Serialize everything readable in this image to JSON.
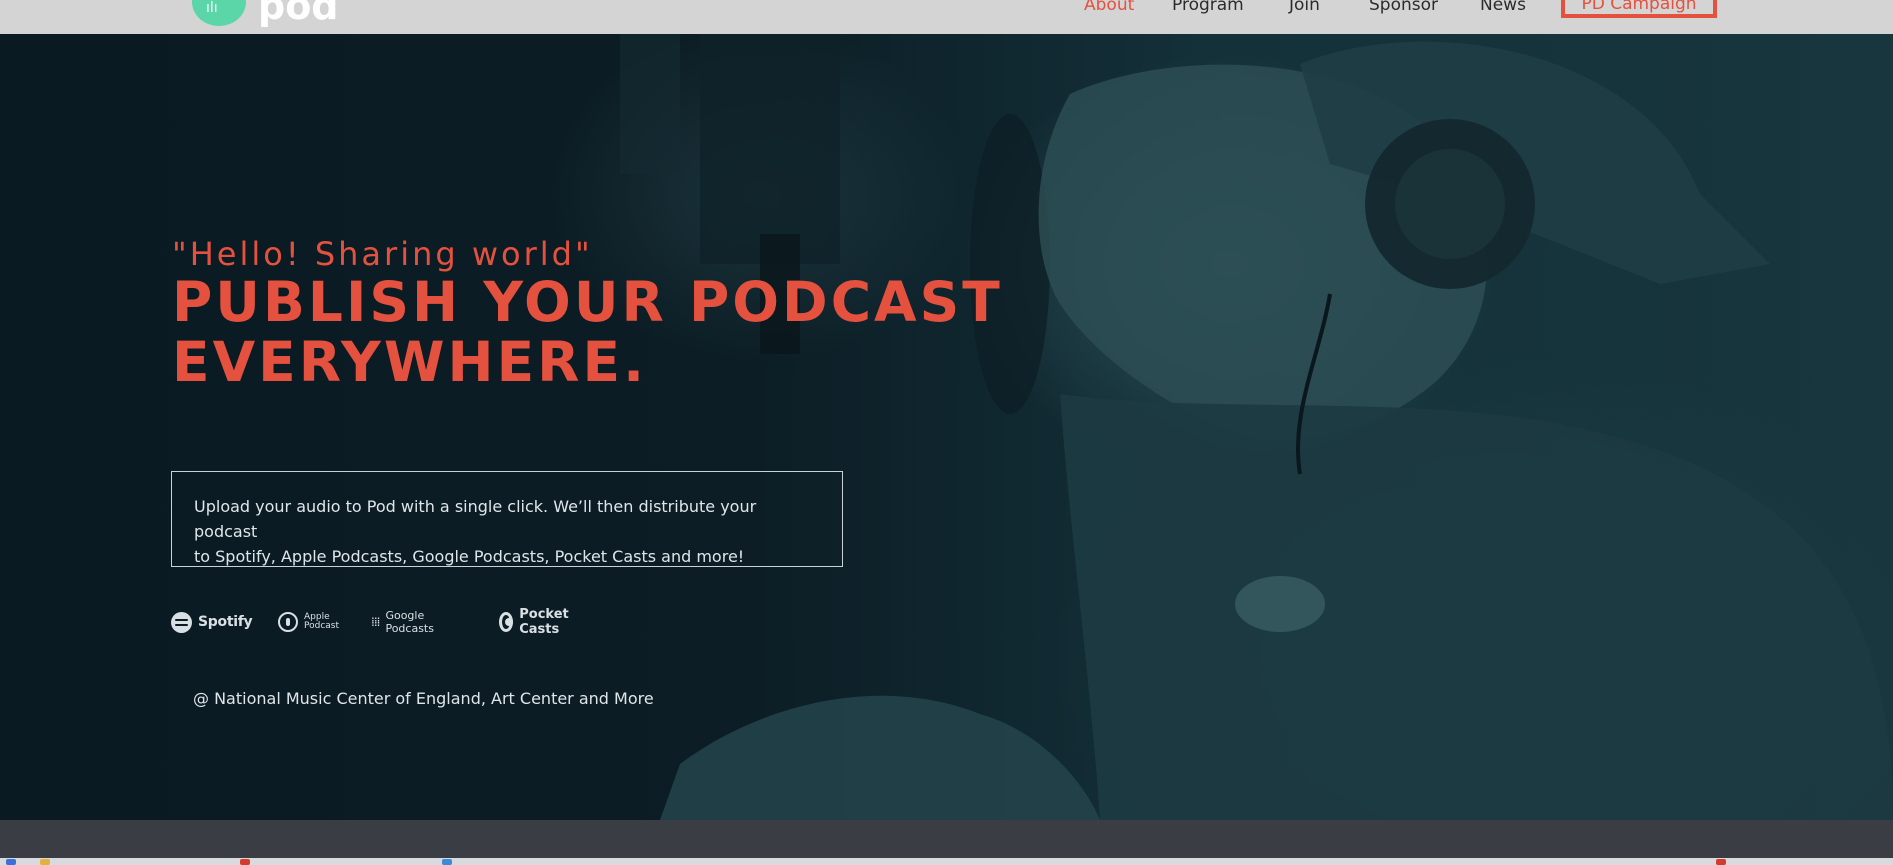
{
  "nav": {
    "logo_text": "pod",
    "links": [
      {
        "label": "About",
        "active": true
      },
      {
        "label": "Program"
      },
      {
        "label": "Join"
      },
      {
        "label": "Sponsor"
      },
      {
        "label": "News"
      }
    ],
    "cta_label": "PD Campaign",
    "accent_color": "#e5513f",
    "logo_color": "#5ad6a8"
  },
  "hero": {
    "tagline": "\"Hello! Sharing world\"",
    "headline_line1": "PUBLISH YOUR PODCAST",
    "headline_line2": "EVERYWHERE.",
    "description_line1": "Upload your audio to Pod with a single click. We’ll then distribute your podcast",
    "description_line2": "to Spotify, Apple Podcasts, Google Podcasts, Pocket Casts and more!",
    "platforms": [
      {
        "name": "Spotify",
        "icon": "spotify-icon"
      },
      {
        "name_line1": "Apple",
        "name_line2": "Podcast",
        "icon": "apple-podcast-icon"
      },
      {
        "name": "Google Podcasts",
        "icon": "google-podcasts-icon"
      },
      {
        "name": "Pocket Casts",
        "icon": "pocket-casts-icon"
      }
    ],
    "location": "@ National Music Center of England, Art Center and More"
  }
}
